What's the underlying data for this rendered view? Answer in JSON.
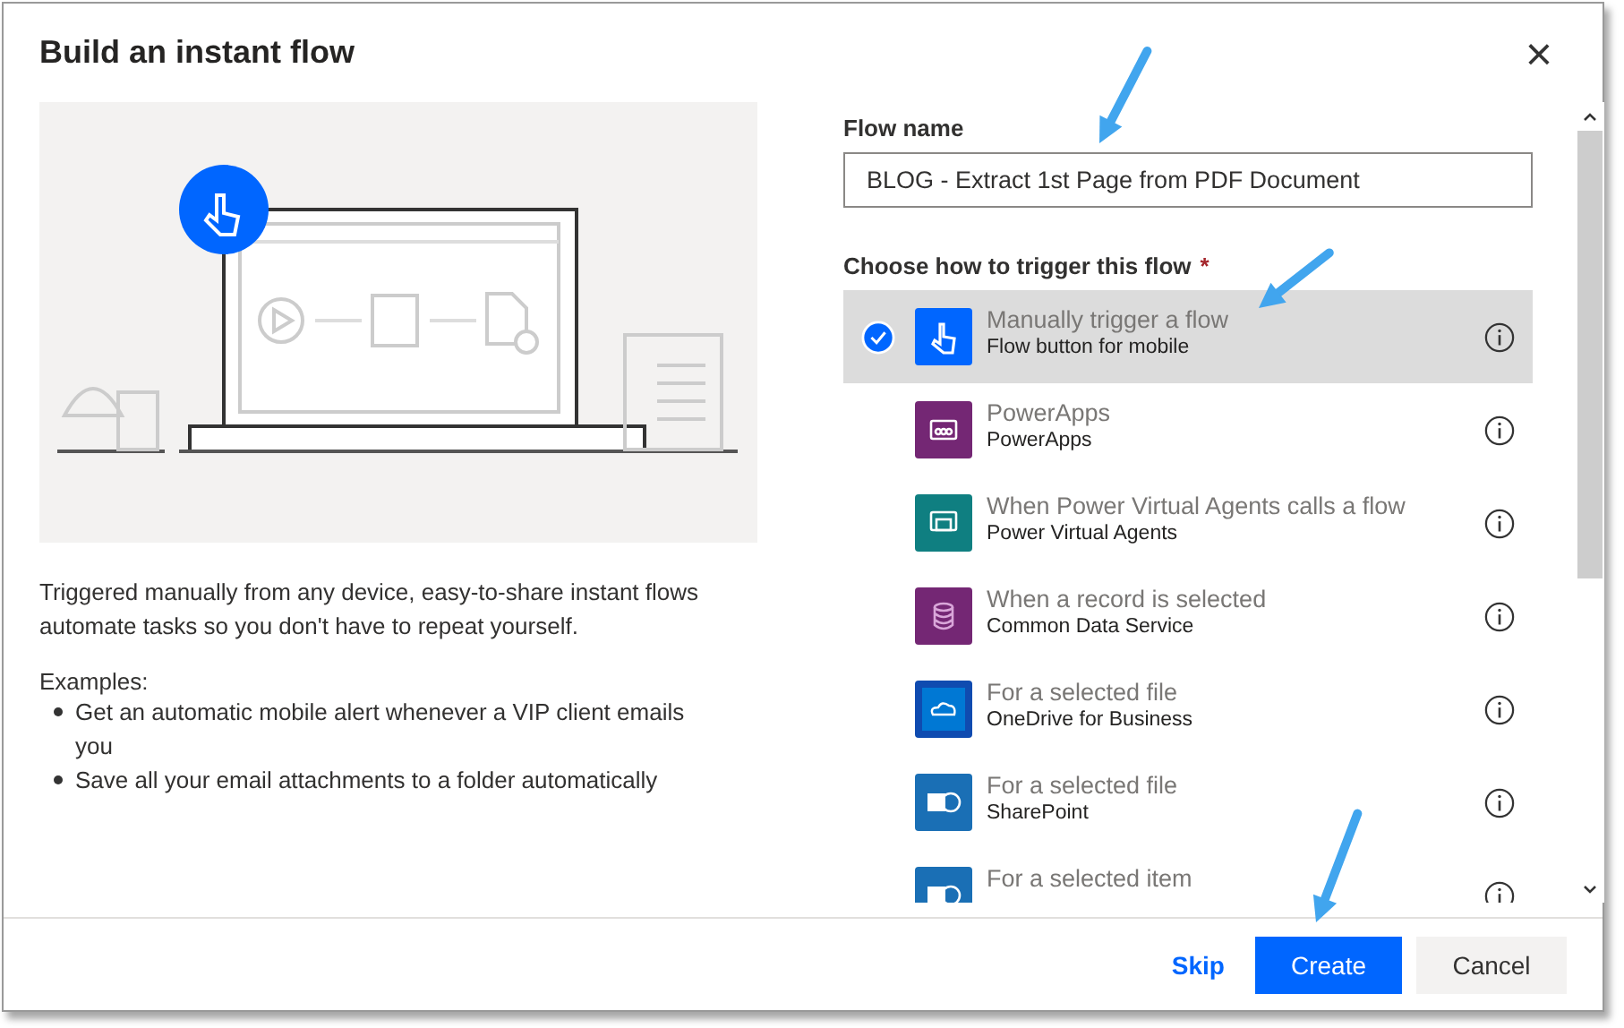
{
  "dialog": {
    "title": "Build an instant flow",
    "close": "×"
  },
  "intro": {
    "description": "Triggered manually from any device, easy-to-share instant flows automate tasks so you don't have to repeat yourself.",
    "examples_label": "Examples:",
    "examples": [
      "Get an automatic mobile alert whenever a VIP client emails you",
      "Save all your email attachments to a folder automatically"
    ]
  },
  "flow_name": {
    "label": "Flow name",
    "value": "BLOG - Extract 1st Page from PDF Document"
  },
  "trigger": {
    "label": "Choose how to trigger this flow",
    "required_mark": "*",
    "options": [
      {
        "title": "Manually trigger a flow",
        "subtitle": "Flow button for mobile",
        "kind": "touch",
        "color": "#0066ff",
        "selected": true
      },
      {
        "title": "PowerApps",
        "subtitle": "PowerApps",
        "kind": "powerapps",
        "color": "#742774",
        "selected": false
      },
      {
        "title": "When Power Virtual Agents calls a flow",
        "subtitle": "Power Virtual Agents",
        "kind": "chat",
        "color": "#0f7f81",
        "selected": false
      },
      {
        "title": "When a record is selected",
        "subtitle": "Common Data Service",
        "kind": "database",
        "color": "#742774",
        "selected": false
      },
      {
        "title": "For a selected file",
        "subtitle": "OneDrive for Business",
        "kind": "cloud",
        "color": "#0f4bb0",
        "selected": false
      },
      {
        "title": "For a selected file",
        "subtitle": "SharePoint",
        "kind": "sharepoint",
        "color": "#1a6fb5",
        "selected": false
      },
      {
        "title": "For a selected item",
        "kind": "sharepoint",
        "color": "#1a6fb5",
        "selected": false
      }
    ]
  },
  "buttons": [
    {
      "label": "Skip",
      "kind": "link"
    },
    {
      "label": "Create",
      "kind": "primary"
    },
    {
      "label": "Cancel",
      "kind": "secondary"
    }
  ]
}
